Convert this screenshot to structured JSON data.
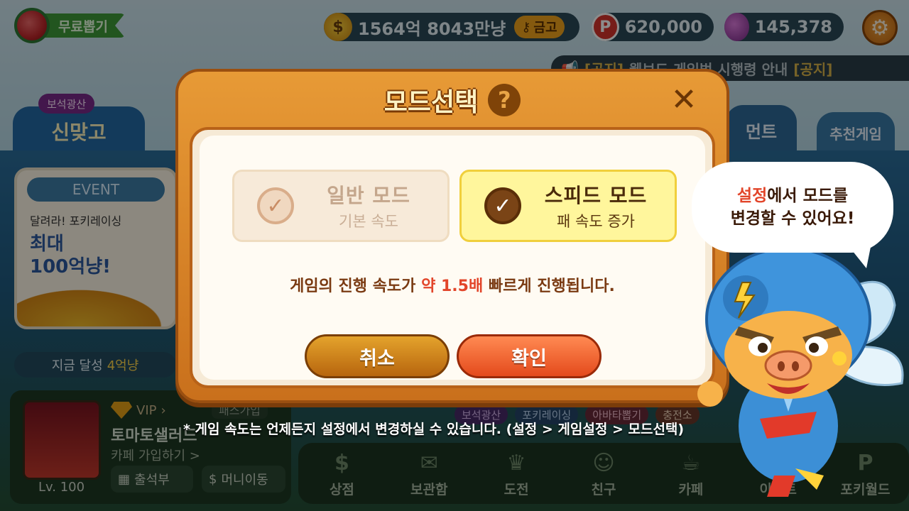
{
  "topbar": {
    "free_draw_label": "무료뽑기",
    "gold_amount": "1564억 8043만냥",
    "vault_label": "금고",
    "points": "620,000",
    "gems": "145,378"
  },
  "notice": {
    "tag": "[공지]",
    "text": "웹보드 게임법 시행령 안내",
    "tag2": "[공지]"
  },
  "tabs": {
    "main_sub": "보석광산",
    "main": "신맞고",
    "tournament": "먼트",
    "recommended": "추천게임"
  },
  "event": {
    "header": "EVENT",
    "line1": "달려라! 포키레이싱",
    "line2": "최대",
    "line3": "100억냥!"
  },
  "achieve": {
    "label": "지금 달성",
    "value": "4억냥"
  },
  "profile": {
    "vip": "VIP",
    "nickname": "토마토샐러드",
    "cafe_join": "카페 가입하기 >",
    "level": "Lv. 100",
    "attend": "출석부",
    "money_move": "머니이동",
    "cafe_tag": "패스가입"
  },
  "chips": [
    "보석광산",
    "포키레이싱",
    "아바타뽑기",
    "충전소"
  ],
  "bottom_nav": [
    {
      "icon": "coin-icon",
      "label": "상점"
    },
    {
      "icon": "box-icon",
      "label": "보관함"
    },
    {
      "icon": "trophy-icon",
      "label": "도전"
    },
    {
      "icon": "friends-icon",
      "label": "친구"
    },
    {
      "icon": "cup-icon",
      "label": "카페"
    },
    {
      "icon": "event-icon",
      "label": "이벤트"
    },
    {
      "icon": "p-icon",
      "label": "포키월드"
    }
  ],
  "modal": {
    "title": "모드선택",
    "normal_mode": {
      "name": "일반 모드",
      "desc": "기본 속도",
      "selected": false
    },
    "speed_mode": {
      "name": "스피드 모드",
      "desc": "패 속도 증가",
      "selected": true
    },
    "message_prefix": "게임의 진행 속도가 ",
    "message_emph": "약 1.5배",
    "message_suffix": " 빠르게 진행됩니다.",
    "cancel_label": "취소",
    "confirm_label": "확인"
  },
  "footnote": "* 게임 속도는 언제든지 설정에서 변경하실 수 있습니다. (설정 > 게임설정 > 모드선택)",
  "bubble": {
    "hl": "설정",
    "rest1": "에서 모드를",
    "line2": "변경할 수 있어요!"
  },
  "colors": {
    "modal_frame": "#d98a2c",
    "speed_selected_bg": "#fff69c",
    "confirm_btn": "#f05a28",
    "cancel_btn": "#c98016",
    "emphasis_text": "#e2452a"
  }
}
